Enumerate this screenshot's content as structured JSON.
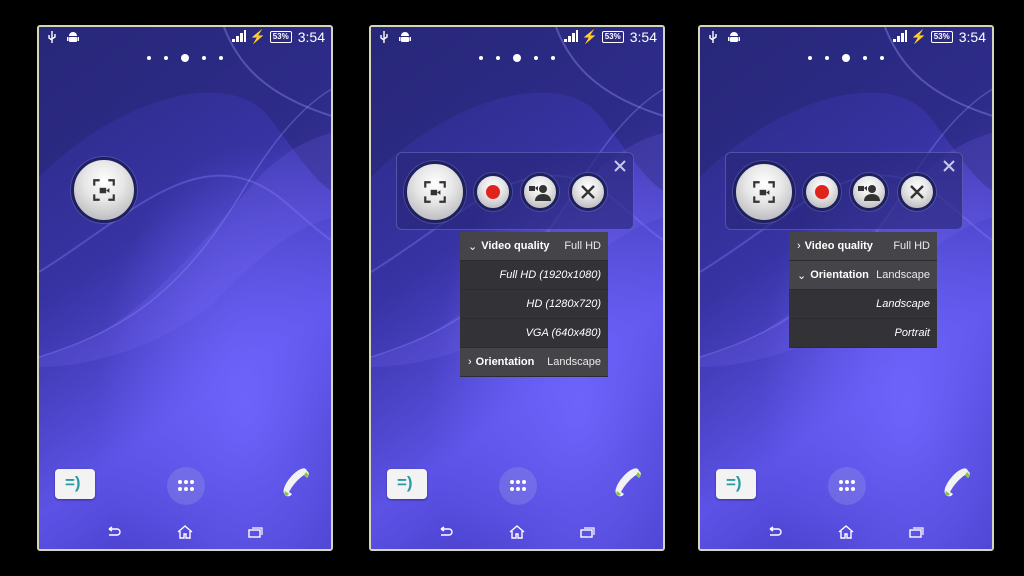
{
  "status_bar": {
    "left_icons": [
      "usb-icon",
      "android-icon"
    ],
    "signal_icon": "signal-icon",
    "charging_icon": "lightning-icon",
    "battery": "53%",
    "time": "3:54"
  },
  "home_pages": {
    "count": 5,
    "active_index": 2
  },
  "screens": [
    {
      "id": "screen-1",
      "state": "collapsed",
      "floating_button": {
        "icon": "screen-record-icon"
      }
    },
    {
      "id": "screen-2",
      "state": "expanded-video-quality",
      "toolbar": {
        "buttons": [
          {
            "name": "screen-record",
            "icon": "screen-record-icon"
          },
          {
            "name": "record",
            "icon": "record-icon"
          },
          {
            "name": "camera-overlay",
            "icon": "camera-person-icon"
          },
          {
            "name": "settings",
            "icon": "tools-icon"
          }
        ],
        "close_icon": "close-icon"
      },
      "menu": {
        "rows": [
          {
            "type": "header",
            "expanded": true,
            "chevron": "⌄",
            "title": "Video quality",
            "value": "Full HD"
          },
          {
            "type": "option",
            "label": "Full HD (1920x1080)"
          },
          {
            "type": "option",
            "label": "HD (1280x720)"
          },
          {
            "type": "option",
            "label": "VGA (640x480)"
          },
          {
            "type": "header",
            "expanded": false,
            "chevron": "›",
            "title": "Orientation",
            "value": "Landscape"
          }
        ]
      }
    },
    {
      "id": "screen-3",
      "state": "expanded-orientation",
      "toolbar": {
        "buttons": [
          {
            "name": "screen-record",
            "icon": "screen-record-icon"
          },
          {
            "name": "record",
            "icon": "record-icon"
          },
          {
            "name": "camera-overlay",
            "icon": "camera-person-icon"
          },
          {
            "name": "settings",
            "icon": "tools-icon"
          }
        ],
        "close_icon": "close-icon"
      },
      "menu": {
        "rows": [
          {
            "type": "header",
            "expanded": false,
            "chevron": "›",
            "title": "Video quality",
            "value": "Full HD"
          },
          {
            "type": "header",
            "expanded": true,
            "chevron": "⌄",
            "title": "Orientation",
            "value": "Landscape"
          },
          {
            "type": "option",
            "label": "Landscape"
          },
          {
            "type": "option",
            "label": "Portrait"
          }
        ]
      }
    }
  ],
  "dock": {
    "messaging_glyph": "=)",
    "items": [
      "messaging-icon",
      "app-drawer-icon",
      "phone-icon"
    ]
  },
  "nav_bar": [
    "back-icon",
    "home-icon",
    "recents-icon"
  ],
  "colors": {
    "wallpaper_dark": "#2c2b86",
    "wallpaper_light": "#6a5ef0",
    "record_red": "#e0241c",
    "menu_bg": "#3b3b3f",
    "frame": "#d8d6b8"
  }
}
